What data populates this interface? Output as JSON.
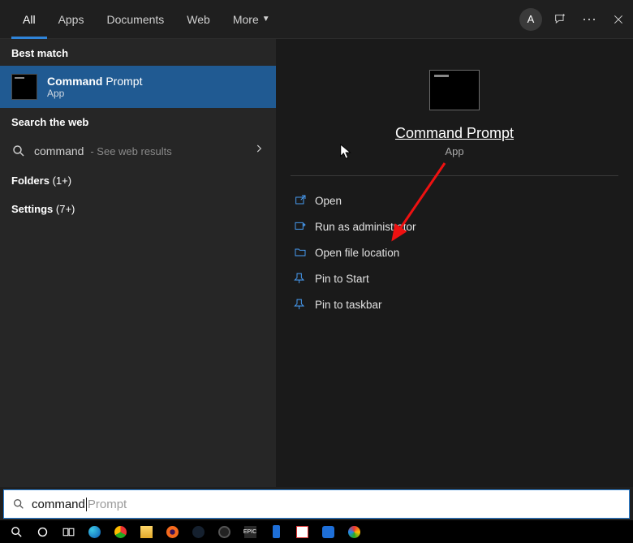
{
  "tabs": {
    "all": "All",
    "apps": "Apps",
    "documents": "Documents",
    "web": "Web",
    "more": "More"
  },
  "header": {
    "avatar_initial": "A",
    "options_glyph": "···"
  },
  "left": {
    "best_match_hdr": "Best match",
    "best_match": {
      "title_bold": "Command",
      "title_rest": " Prompt",
      "subtitle": "App"
    },
    "web_hdr": "Search the web",
    "web_row": {
      "term": "command",
      "hint": "- See web results"
    },
    "folders": {
      "label": "Folders ",
      "count": "(1+)"
    },
    "settings": {
      "label": "Settings ",
      "count": "(7+)"
    }
  },
  "right": {
    "title": "Command Prompt",
    "subtitle": "App",
    "actions": {
      "open": "Open",
      "run_admin": "Run as administrator",
      "open_location": "Open file location",
      "pin_start": "Pin to Start",
      "pin_taskbar": "Pin to taskbar"
    }
  },
  "search": {
    "typed": "command",
    "suggestion": "Prompt"
  }
}
